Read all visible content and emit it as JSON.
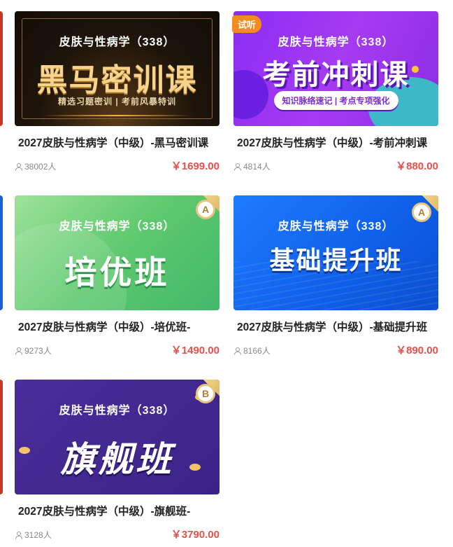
{
  "cards": [
    {
      "subject": "皮肤与性病学（338）",
      "course_name": "黑马密训课",
      "slogan": "精选习题密训 | 考前风暴特训",
      "title": "2027皮肤与性病学（中级）-黑马密训课",
      "students": "38002人",
      "price": "￥1699.00"
    },
    {
      "badge": "试听",
      "subject": "皮肤与性病学（338）",
      "course_name": "考前冲刺课",
      "slogan": "知识脉络速记 | 考点专项强化",
      "title": "2027皮肤与性病学（中级）-考前冲刺课",
      "students": "4814人",
      "price": "￥880.00"
    },
    {
      "subject": "皮肤与性病学（338）",
      "course_name": "培优班",
      "medal": "A",
      "title": "2027皮肤与性病学（中级）-培优班-",
      "students": "9273人",
      "price": "￥1490.00"
    },
    {
      "subject": "皮肤与性病学（338）",
      "course_name": "基础提升班",
      "medal": "A",
      "title": "2027皮肤与性病学（中级）-基础提升班",
      "students": "8166人",
      "price": "￥890.00"
    },
    {
      "subject": "皮肤与性病学（338）",
      "course_name": "旗舰班",
      "medal": "B",
      "title": "2027皮肤与性病学（中级）-旗舰班-",
      "students": "3128人",
      "price": "￥3790.00"
    }
  ],
  "icons": {
    "students": "user-icon"
  },
  "colors": {
    "price": "#e8504a",
    "trial_badge": "#f58a1f"
  }
}
